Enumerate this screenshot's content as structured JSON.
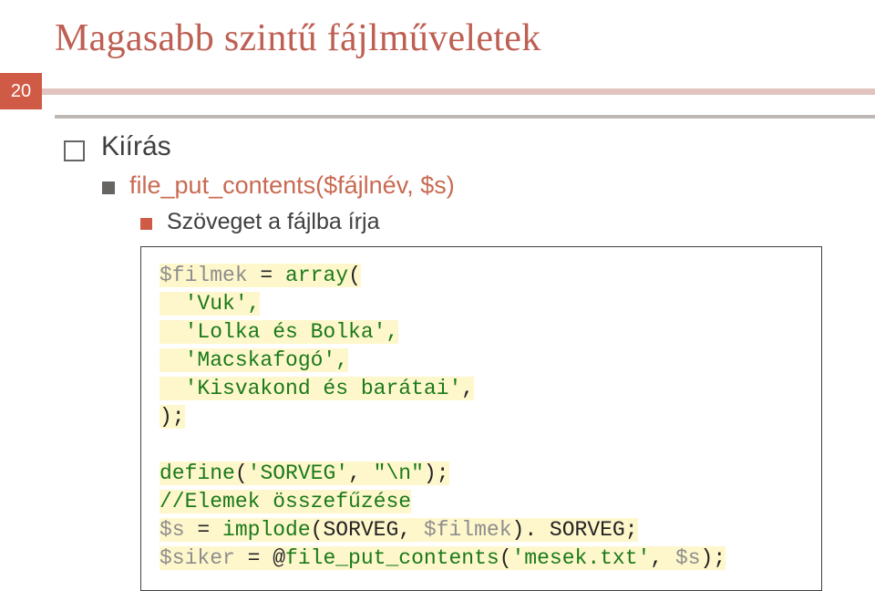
{
  "title": "Magasabb szintű fájlműveletek",
  "pageNumber": "20",
  "bullet1": "Kiírás",
  "bullet2": "file_put_contents($fájlnév, $s)",
  "bullet3": "Szöveget a fájlba írja",
  "code": {
    "l1a": "$filmek",
    "l1b": " = ",
    "l1c": "array",
    "l1d": "(",
    "l2": "  'Vuk',",
    "l3": "  'Lolka és Bolka',",
    "l4": "  'Macskafogó',",
    "l5a": "  'Kisvakond és barátai'",
    "l5b": ",",
    "l6": ");",
    "l7": "",
    "l8a": "define",
    "l8b": "(",
    "l8c": "'SORVEG'",
    "l8d": ", ",
    "l8e": "\"\\n\"",
    "l8f": ");",
    "l9": "//Elemek összefűzése",
    "l10a": "$s",
    "l10b": " = ",
    "l10c": "implode",
    "l10d": "(SORVEG, ",
    "l10e": "$filmek",
    "l10f": "). SORVEG;",
    "l11a": "$siker",
    "l11b": " = @",
    "l11c": "file_put_contents",
    "l11d": "(",
    "l11e": "'mesek.txt'",
    "l11f": ", ",
    "l11g": "$s",
    "l11h": ");"
  }
}
